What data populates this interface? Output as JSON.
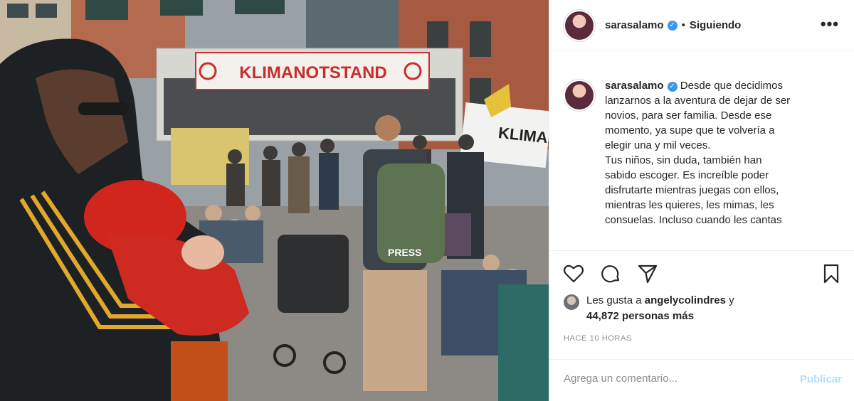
{
  "post": {
    "photo": {
      "banner_text": "KLIMANOTSTAND",
      "side_sign_text": "KLIMA.",
      "jacket_print": "PRESS",
      "alt_description_icon": "photo"
    },
    "header": {
      "username": "sarasalamo",
      "verified_icon": "verified-badge-icon",
      "separator": "•",
      "follow_status": "Siguiendo",
      "more_icon": "more-options-icon"
    },
    "caption": {
      "username": "sarasalamo",
      "lines": [
        "Desde que decidimos",
        "lanzarnos a la aventura de dejar de ser",
        "novios, para ser familia. Desde ese",
        "momento, ya supe que te volvería a",
        "elegir una y mil veces.",
        "Tus niños, sin duda, también han",
        "sabido escoger. Es increíble poder",
        "disfrutarte mientras juegas con ellos,",
        "mientras les quieres, les mimas, les",
        "consuelas. Incluso cuando les cantas"
      ]
    },
    "actions": {
      "like_icon": "heart-icon",
      "comment_icon": "comment-icon",
      "share_icon": "share-icon",
      "save_icon": "bookmark-icon"
    },
    "likes": {
      "prefix": "Les gusta a",
      "first_user": "angelycolindres",
      "conjunction": "y",
      "count_text": "44,872 personas más"
    },
    "timestamp": "HACE 10 HORAS",
    "comment": {
      "placeholder": "Agrega un comentario...",
      "publish_label": "Publicar"
    },
    "colors": {
      "verified": "#3897f0",
      "publish_disabled": "#b2dffc",
      "muted_text": "#8e8e8e",
      "border": "#efefef"
    }
  }
}
